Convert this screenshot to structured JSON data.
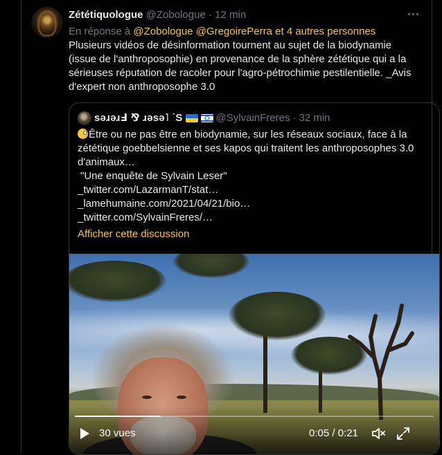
{
  "tweet": {
    "author_name": "Zététiquologue",
    "author_handle": "@Zobologue",
    "separator": "·",
    "time": "12 min",
    "reply_prefix": "En réponse à",
    "reply_mention_1": "@Zobologue",
    "reply_mention_2": "@GregoirePerra",
    "reply_others": "et 4 autres personnes",
    "body": "Plusieurs vidéos de désinformation tournent au sujet de la biodynamie (issue de l'anthroposophie) en provenance de la sphère zététique qui a la sérieuses réputation de racoler pour l'agro-pétrochimie pestilentielle. _Avis d'expert non anthroposophe 3.0"
  },
  "quoted": {
    "author_name": "sǝɹǝɹℲ ⅋ ɹǝsǝ˥ ˙S",
    "author_handle": "@SylvainFreres",
    "separator": "·",
    "time": "32 min",
    "line1": "Être ou ne pas être en biodynamie, sur les réseaux sociaux, face à la zététique goebbelsienne et ses kapos qui traitent les anthroposophes 3.0 d'animaux…",
    "line2": "\"Une enquête de Sylvain Leser\"",
    "link1": "_twitter.com/LazarmanT/stat…",
    "link2": "_lamehumaine.com/2021/04/21/bio…",
    "link3": "_twitter.com/SylvainFreres/…",
    "show_thread": "Afficher cette discussion"
  },
  "video": {
    "views": "30 vues",
    "time_display": "0:05 / 0:21",
    "progress_fraction": 0.24
  },
  "icons": {
    "more": "more-horizontal-icon",
    "play": "play-icon",
    "mute": "volume-muted-icon",
    "fullscreen": "expand-icon"
  },
  "colors": {
    "background": "#000000",
    "text": "#e7e9ea",
    "muted": "#71767b",
    "accent": "#fcc729",
    "border": "#2f3336"
  }
}
